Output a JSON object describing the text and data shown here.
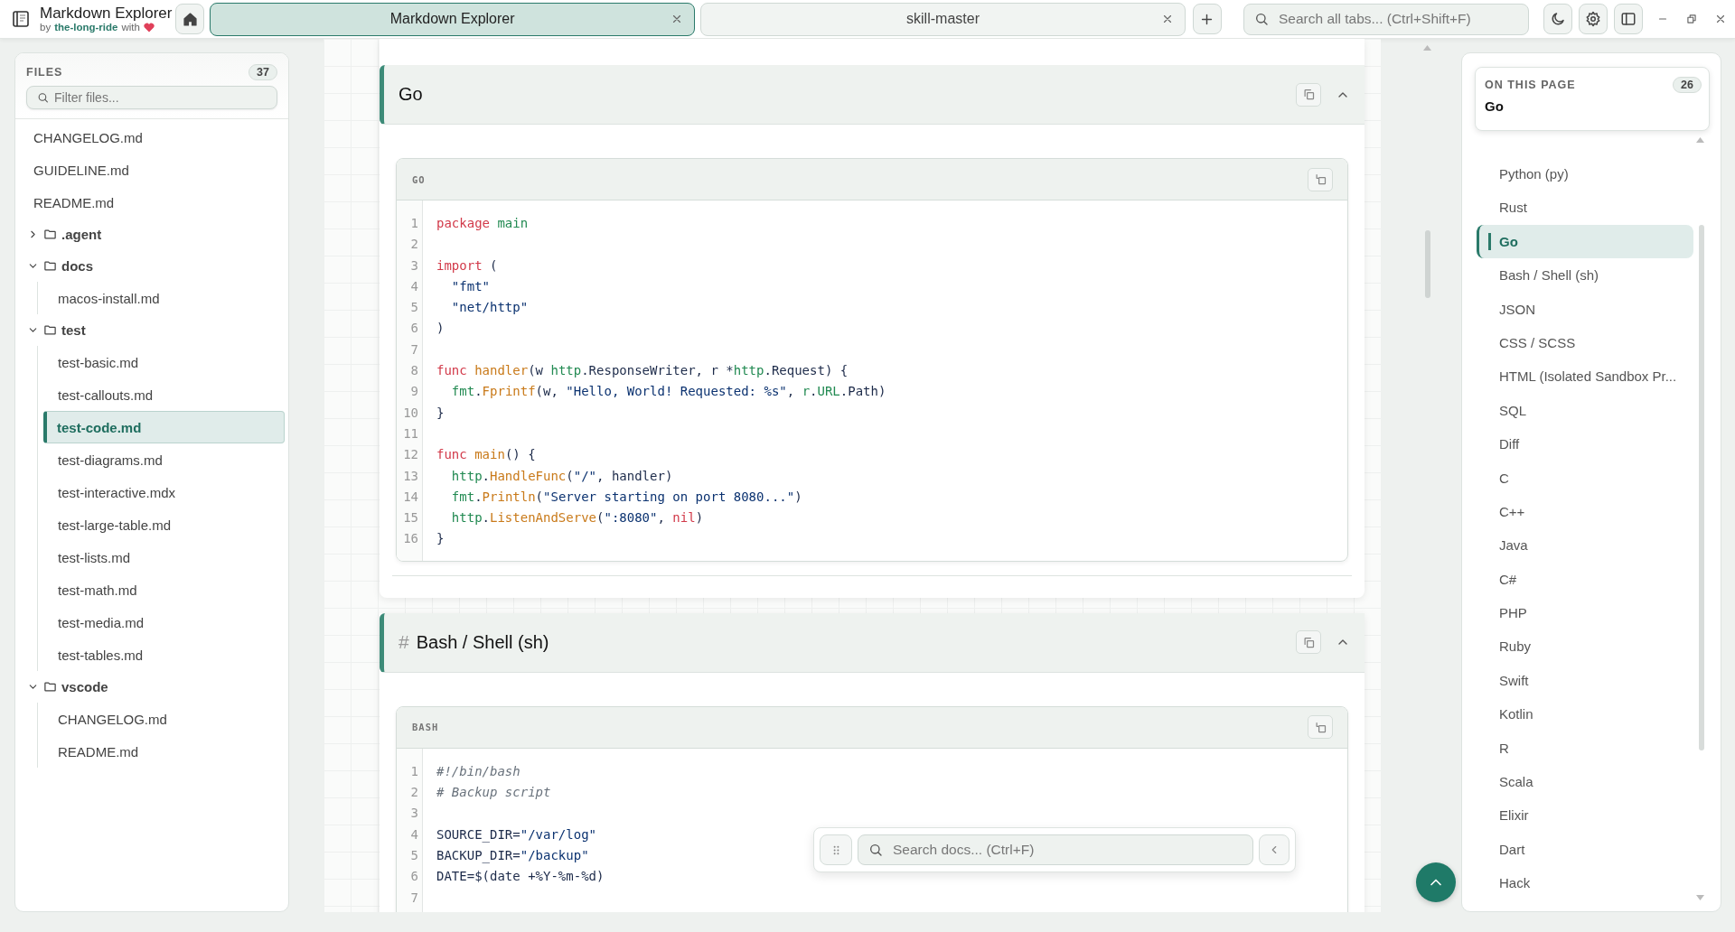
{
  "app": {
    "title": "Markdown Explorer",
    "byline_prefix": "by",
    "author": "the-long-ride",
    "byline_suffix": "with"
  },
  "tabs": [
    {
      "label": "Markdown Explorer",
      "selected": true
    },
    {
      "label": "skill-master",
      "selected": false
    }
  ],
  "search_all": {
    "placeholder": "Search all tabs... (Ctrl+Shift+F)"
  },
  "files": {
    "title": "FILES",
    "count": "37",
    "filter_placeholder": "Filter files...",
    "tree": [
      {
        "name": "CHANGELOG.md",
        "kind": "file",
        "selected": false
      },
      {
        "name": "GUIDELINE.md",
        "kind": "file",
        "selected": false
      },
      {
        "name": "README.md",
        "kind": "file",
        "selected": false
      },
      {
        "name": ".agent",
        "kind": "folder",
        "expanded": false
      },
      {
        "name": "docs",
        "kind": "folder",
        "expanded": true,
        "children": [
          {
            "name": "macos-install.md",
            "kind": "file",
            "selected": false
          }
        ]
      },
      {
        "name": "test",
        "kind": "folder",
        "expanded": true,
        "children": [
          {
            "name": "test-basic.md",
            "kind": "file",
            "selected": false
          },
          {
            "name": "test-callouts.md",
            "kind": "file",
            "selected": false
          },
          {
            "name": "test-code.md",
            "kind": "file",
            "selected": true
          },
          {
            "name": "test-diagrams.md",
            "kind": "file",
            "selected": false
          },
          {
            "name": "test-interactive.mdx",
            "kind": "file",
            "selected": false
          },
          {
            "name": "test-large-table.md",
            "kind": "file",
            "selected": false
          },
          {
            "name": "test-lists.md",
            "kind": "file",
            "selected": false
          },
          {
            "name": "test-math.md",
            "kind": "file",
            "selected": false
          },
          {
            "name": "test-media.md",
            "kind": "file",
            "selected": false
          },
          {
            "name": "test-tables.md",
            "kind": "file",
            "selected": false
          }
        ]
      },
      {
        "name": "vscode",
        "kind": "folder",
        "expanded": true,
        "children": [
          {
            "name": "CHANGELOG.md",
            "kind": "file",
            "selected": false
          },
          {
            "name": "README.md",
            "kind": "file",
            "selected": false
          }
        ]
      }
    ]
  },
  "sections": [
    {
      "title": "Go",
      "language": "GO",
      "lines": [
        {
          "n": "1",
          "tokens": [
            {
              "text": "package",
              "kind": "kw"
            },
            {
              "text": " main",
              "kind": "type"
            }
          ]
        },
        {
          "n": "2"
        },
        {
          "n": "3",
          "tokens": [
            {
              "text": "import",
              "kind": "kw"
            },
            {
              "text": " (",
              "kind": "plain"
            }
          ]
        },
        {
          "n": "4",
          "tokens": [
            {
              "text": "  \"fmt\"",
              "kind": "str"
            }
          ]
        },
        {
          "n": "5",
          "tokens": [
            {
              "text": "  \"net/http\"",
              "kind": "str"
            }
          ]
        },
        {
          "n": "6",
          "tokens": [
            {
              "text": ")",
              "kind": "plain"
            }
          ]
        },
        {
          "n": "7"
        },
        {
          "n": "8",
          "tokens": [
            {
              "text": "func",
              "kind": "kw"
            },
            {
              "text": " handler",
              "kind": "fn"
            },
            {
              "text": "(w ",
              "kind": "plain"
            },
            {
              "text": "http",
              "kind": "type"
            },
            {
              "text": ".ResponseWriter, r *",
              "kind": "plain"
            },
            {
              "text": "http",
              "kind": "type"
            },
            {
              "text": ".Request) {",
              "kind": "plain"
            }
          ]
        },
        {
          "n": "9",
          "tokens": [
            {
              "text": "  fmt",
              "kind": "type"
            },
            {
              "text": ".",
              "kind": "plain"
            },
            {
              "text": "Fprintf",
              "kind": "fn"
            },
            {
              "text": "(w, ",
              "kind": "plain"
            },
            {
              "text": "\"Hello, World! Requested: %s\"",
              "kind": "str"
            },
            {
              "text": ", ",
              "kind": "plain"
            },
            {
              "text": "r",
              "kind": "type"
            },
            {
              "text": ".",
              "kind": "plain"
            },
            {
              "text": "URL",
              "kind": "type"
            },
            {
              "text": ".Path)",
              "kind": "plain"
            }
          ]
        },
        {
          "n": "10",
          "tokens": [
            {
              "text": "}",
              "kind": "plain"
            }
          ]
        },
        {
          "n": "11"
        },
        {
          "n": "12",
          "tokens": [
            {
              "text": "func",
              "kind": "kw"
            },
            {
              "text": " main",
              "kind": "fn"
            },
            {
              "text": "() {",
              "kind": "plain"
            }
          ]
        },
        {
          "n": "13",
          "tokens": [
            {
              "text": "  http",
              "kind": "type"
            },
            {
              "text": ".",
              "kind": "plain"
            },
            {
              "text": "HandleFunc",
              "kind": "fn"
            },
            {
              "text": "(",
              "kind": "plain"
            },
            {
              "text": "\"/\"",
              "kind": "str"
            },
            {
              "text": ", handler)",
              "kind": "plain"
            }
          ]
        },
        {
          "n": "14",
          "tokens": [
            {
              "text": "  fmt",
              "kind": "type"
            },
            {
              "text": ".",
              "kind": "plain"
            },
            {
              "text": "Println",
              "kind": "fn"
            },
            {
              "text": "(",
              "kind": "plain"
            },
            {
              "text": "\"Server starting on port 8080...\"",
              "kind": "str"
            },
            {
              "text": ")",
              "kind": "plain"
            }
          ]
        },
        {
          "n": "15",
          "tokens": [
            {
              "text": "  http",
              "kind": "type"
            },
            {
              "text": ".",
              "kind": "plain"
            },
            {
              "text": "ListenAndServe",
              "kind": "fn"
            },
            {
              "text": "(",
              "kind": "plain"
            },
            {
              "text": "\":8080\"",
              "kind": "str"
            },
            {
              "text": ", ",
              "kind": "plain"
            },
            {
              "text": "nil",
              "kind": "kw"
            },
            {
              "text": ")",
              "kind": "plain"
            }
          ]
        },
        {
          "n": "16",
          "tokens": [
            {
              "text": "}",
              "kind": "plain"
            }
          ]
        }
      ]
    },
    {
      "title": "Bash / Shell (sh)",
      "anchor": "#",
      "language": "BASH",
      "lines": [
        {
          "n": "1",
          "tokens": [
            {
              "text": "#!/bin/bash",
              "kind": "comment"
            }
          ]
        },
        {
          "n": "2",
          "tokens": [
            {
              "text": "# Backup script",
              "kind": "comment"
            }
          ]
        },
        {
          "n": "3"
        },
        {
          "n": "4",
          "tokens": [
            {
              "text": "SOURCE_DIR=",
              "kind": "plain"
            },
            {
              "text": "\"/var/log\"",
              "kind": "str"
            }
          ]
        },
        {
          "n": "5",
          "tokens": [
            {
              "text": "BACKUP_DIR=",
              "kind": "plain"
            },
            {
              "text": "\"/backup\"",
              "kind": "str"
            }
          ]
        },
        {
          "n": "6",
          "tokens": [
            {
              "text": "DATE=$(date +%Y-%m-%d)",
              "kind": "plain"
            }
          ]
        },
        {
          "n": "7"
        }
      ]
    }
  ],
  "doc_search": {
    "placeholder": "Search docs... (Ctrl+F)"
  },
  "toc": {
    "title": "ON THIS PAGE",
    "count": "26",
    "current": "Go",
    "items": [
      {
        "label": "Python (py)",
        "selected": false
      },
      {
        "label": "Rust",
        "selected": false
      },
      {
        "label": "Go",
        "selected": true
      },
      {
        "label": "Bash / Shell (sh)",
        "selected": false
      },
      {
        "label": "JSON",
        "selected": false
      },
      {
        "label": "CSS / SCSS",
        "selected": false
      },
      {
        "label": "HTML (Isolated Sandbox Pr...",
        "selected": false
      },
      {
        "label": "SQL",
        "selected": false
      },
      {
        "label": "Diff",
        "selected": false
      },
      {
        "label": "C",
        "selected": false
      },
      {
        "label": "C++",
        "selected": false
      },
      {
        "label": "Java",
        "selected": false
      },
      {
        "label": "C#",
        "selected": false
      },
      {
        "label": "PHP",
        "selected": false
      },
      {
        "label": "Ruby",
        "selected": false
      },
      {
        "label": "Swift",
        "selected": false
      },
      {
        "label": "Kotlin",
        "selected": false
      },
      {
        "label": "R",
        "selected": false
      },
      {
        "label": "Scala",
        "selected": false
      },
      {
        "label": "Elixir",
        "selected": false
      },
      {
        "label": "Dart",
        "selected": false
      },
      {
        "label": "Hack",
        "selected": false
      }
    ]
  }
}
